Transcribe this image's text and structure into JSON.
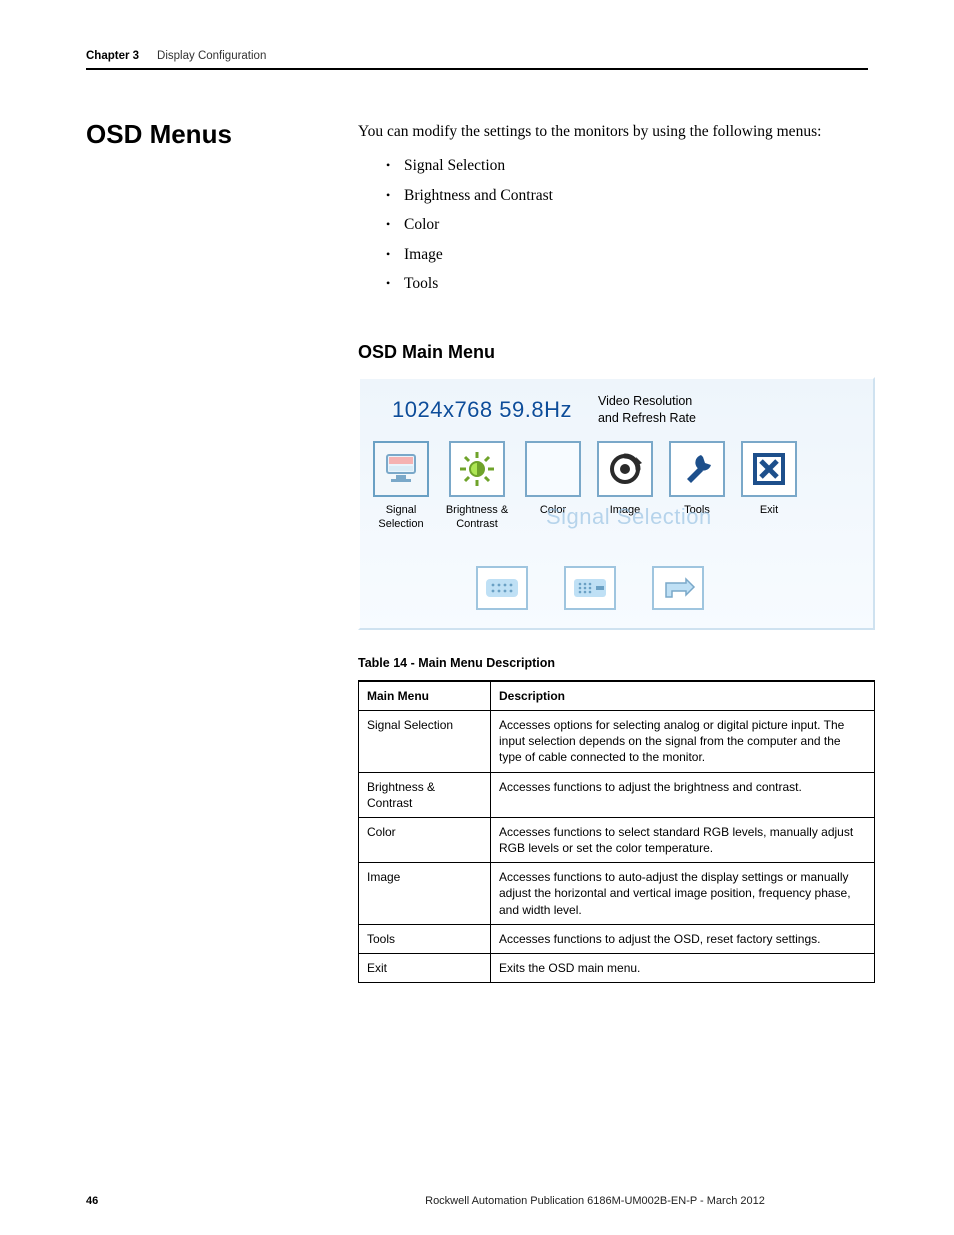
{
  "header": {
    "chapter": "Chapter 3",
    "title": "Display Configuration"
  },
  "sidehead": "OSD Menus",
  "intro": "You can modify the settings to the monitors by using the following menus:",
  "bullets": [
    "Signal Selection",
    "Brightness and Contrast",
    "Color",
    "Image",
    "Tools"
  ],
  "h2": "OSD Main Menu",
  "osd": {
    "resolution": "1024x768  59.8Hz",
    "res_caption": "Video Resolution and Refresh Rate",
    "ghost": "Signal Selection",
    "icons": [
      {
        "name": "signal-selection-icon",
        "caption": "Signal Selection"
      },
      {
        "name": "brightness-contrast-icon",
        "caption": "Brightness & Contrast"
      },
      {
        "name": "color-icon",
        "caption": "Color"
      },
      {
        "name": "image-icon",
        "caption": "Image"
      },
      {
        "name": "tools-icon",
        "caption": "Tools"
      },
      {
        "name": "exit-icon",
        "caption": "Exit"
      }
    ]
  },
  "table_caption": "Table 14 - Main Menu Description",
  "table": {
    "headers": [
      "Main Menu",
      "Description"
    ],
    "rows": [
      {
        "menu": "Signal Selection",
        "desc": "Accesses options for selecting analog or digital picture input. The input selection depends on the signal from the computer and the type of cable connected to the monitor."
      },
      {
        "menu": "Brightness & Contrast",
        "desc": "Accesses functions to adjust the brightness and contrast."
      },
      {
        "menu": "Color",
        "desc": "Accesses functions to select standard RGB levels, manually adjust RGB levels or set the color temperature."
      },
      {
        "menu": "Image",
        "desc": "Accesses functions to auto-adjust the display settings or manually adjust the horizontal and vertical image position, frequency phase, and width level."
      },
      {
        "menu": "Tools",
        "desc": "Accesses functions to adjust the OSD, reset factory settings."
      },
      {
        "menu": "Exit",
        "desc": "Exits the OSD main menu."
      }
    ]
  },
  "footer": {
    "page": "46",
    "pub": "Rockwell Automation Publication 6186M-UM002B-EN-P - March 2012"
  }
}
